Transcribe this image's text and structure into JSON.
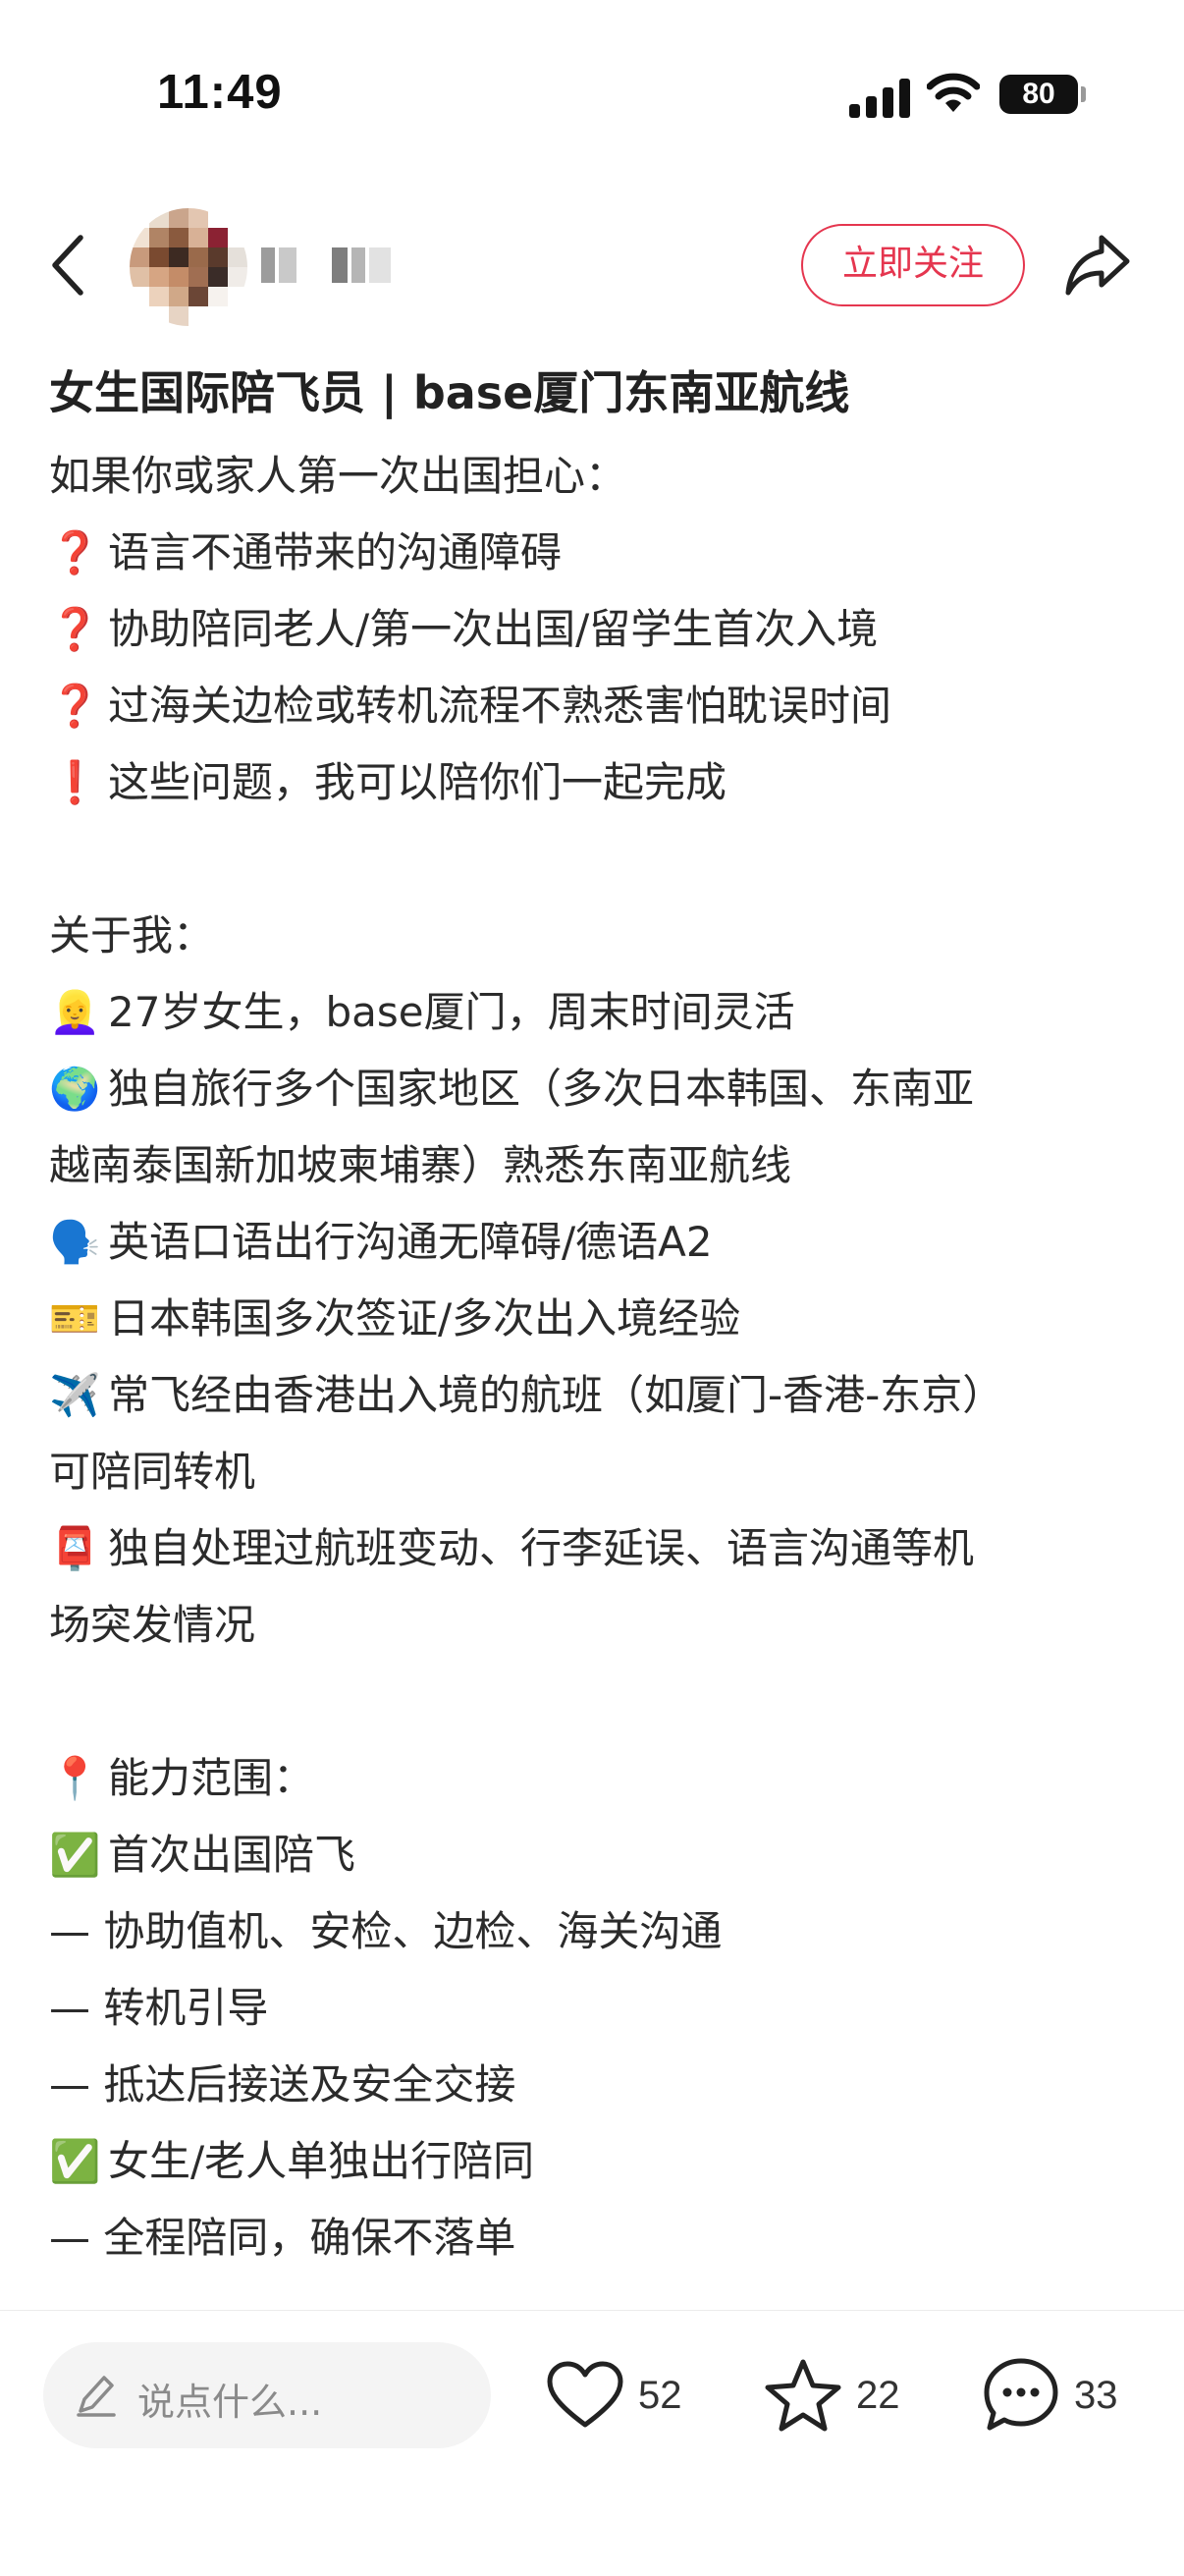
{
  "status": {
    "time": "11:49",
    "battery": "80"
  },
  "header": {
    "follow_label": "立即关注"
  },
  "post": {
    "title": "女生国际陪飞员 | base厦门东南亚航线",
    "lines": [
      {
        "emoji": "",
        "text": "如果你或家人第一次出国担心："
      },
      {
        "emoji": "❓",
        "text": "语言不通带来的沟通障碍"
      },
      {
        "emoji": "❓",
        "text": "协助陪同老人/第一次出国/留学生首次入境"
      },
      {
        "emoji": "❓",
        "text": "过海关边检或转机流程不熟悉害怕耽误时间"
      },
      {
        "emoji": "❗",
        "text": "这些问题，我可以陪你们一起完成"
      },
      {
        "emoji": "",
        "text": ""
      },
      {
        "emoji": "",
        "text": "关于我："
      },
      {
        "emoji": "👱‍♀️",
        "text": "27岁女生，base厦门，周末时间灵活"
      },
      {
        "emoji": "🌍",
        "text": "独自旅行多个国家地区（多次日本韩国、东南亚"
      },
      {
        "emoji": "",
        "text": "越南泰国新加坡柬埔寨）熟悉东南亚航线"
      },
      {
        "emoji": "🗣️",
        "text": "英语口语出行沟通无障碍/德语A2"
      },
      {
        "emoji": "🎫",
        "text": "日本韩国多次签证/多次出入境经验"
      },
      {
        "emoji": "✈️",
        "text": "常飞经由香港出入境的航班（如厦门-香港-东京）"
      },
      {
        "emoji": "",
        "text": "可陪同转机"
      },
      {
        "emoji": "📮",
        "text": "独自处理过航班变动、行李延误、语言沟通等机"
      },
      {
        "emoji": "",
        "text": "场突发情况"
      },
      {
        "emoji": "",
        "text": ""
      },
      {
        "emoji": "📍",
        "text": "能力范围："
      },
      {
        "emoji": "✅",
        "text": "首次出国陪飞"
      },
      {
        "emoji": "",
        "text": "— 协助值机、安检、边检、海关沟通"
      },
      {
        "emoji": "",
        "text": "— 转机引导"
      },
      {
        "emoji": "",
        "text": "— 抵达后接送及安全交接"
      },
      {
        "emoji": "✅",
        "text": "女生/老人单独出行陪同"
      },
      {
        "emoji": "",
        "text": "— 全程陪同，确保不落单"
      }
    ]
  },
  "bottom": {
    "comment_placeholder": "说点什么...",
    "likes": "52",
    "favorites": "22",
    "comments": "33"
  },
  "colors": {
    "accent": "#e5364f",
    "text": "#2b2b2b"
  },
  "icons": [
    "back-arrow-icon",
    "share-icon",
    "edit-icon",
    "heart-icon",
    "star-icon",
    "comment-icon"
  ]
}
